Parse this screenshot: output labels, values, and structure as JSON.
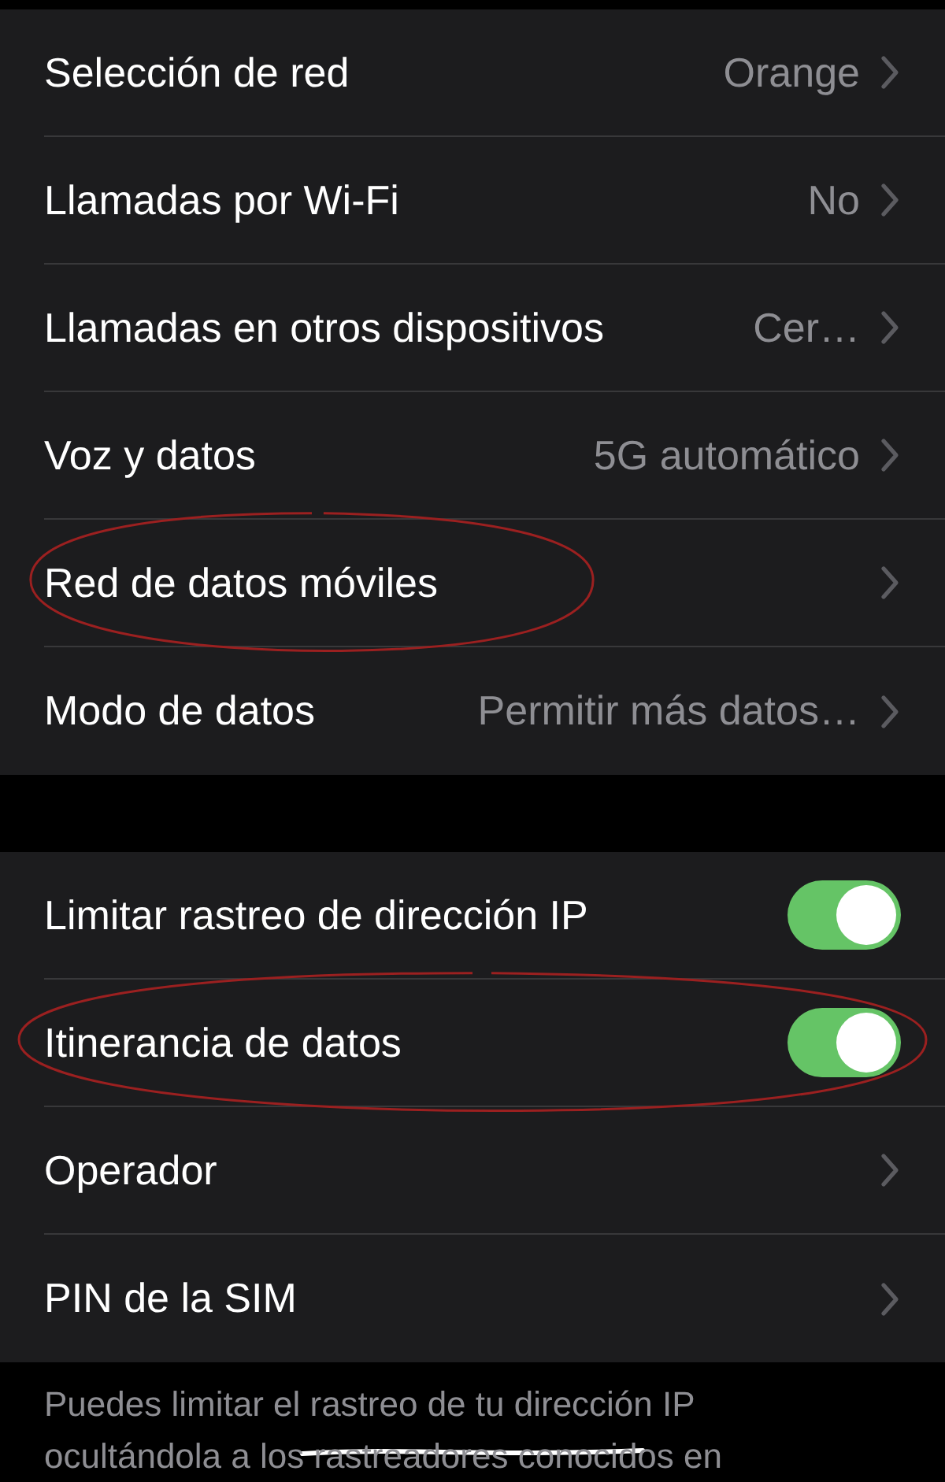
{
  "groups": [
    {
      "rows": [
        {
          "kind": "nav",
          "label": "Selección de red",
          "value": "Orange",
          "highlighted": false
        },
        {
          "kind": "nav",
          "label": "Llamadas por Wi-Fi",
          "value": "No",
          "highlighted": false
        },
        {
          "kind": "nav",
          "label": "Llamadas en otros dispositivos",
          "value": "Cer…",
          "highlighted": false
        },
        {
          "kind": "nav",
          "label": "Voz y datos",
          "value": "5G automático",
          "highlighted": false
        },
        {
          "kind": "nav",
          "label": "Red de datos móviles",
          "highlighted": true
        },
        {
          "kind": "nav",
          "label": "Modo de datos",
          "value": "Permitir más datos…",
          "highlighted": false
        }
      ]
    },
    {
      "rows": [
        {
          "kind": "toggle",
          "label": "Limitar rastreo de dirección IP",
          "on": true,
          "highlighted": false
        },
        {
          "kind": "toggle",
          "label": "Itinerancia de datos",
          "on": true,
          "highlighted": true
        },
        {
          "kind": "nav",
          "label": "Operador",
          "highlighted": false
        },
        {
          "kind": "nav",
          "label": "PIN de la SIM",
          "highlighted": false
        }
      ]
    }
  ],
  "footer": {
    "lines": [
      "Puedes limitar el rastreo de tu dirección IP",
      "ocultándola a los rastreadores conocidos en"
    ],
    "struck": true
  }
}
